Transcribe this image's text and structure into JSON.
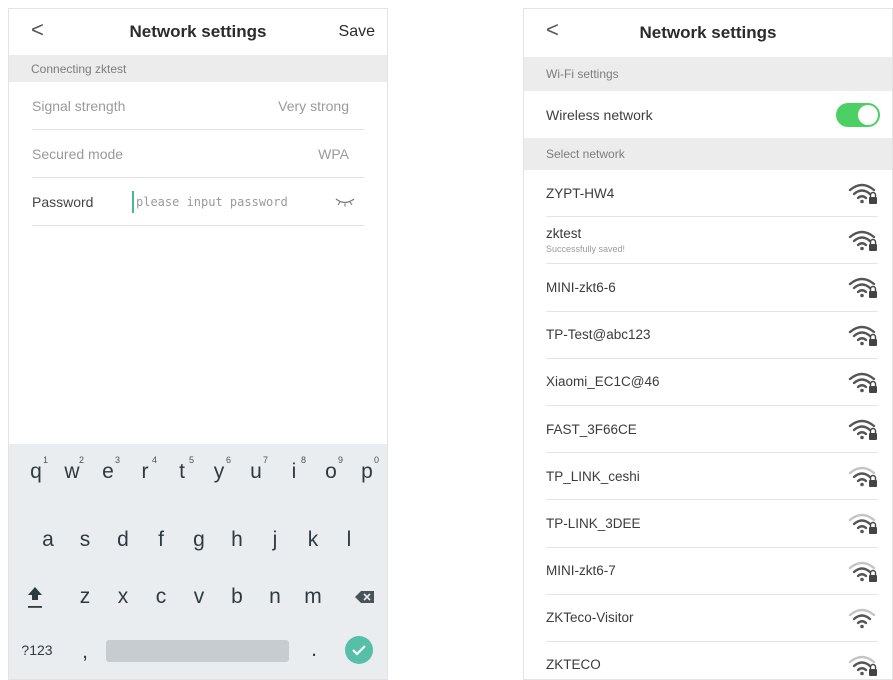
{
  "left": {
    "header": {
      "back": "<",
      "title": "Network settings",
      "save": "Save"
    },
    "section": "Connecting zktest",
    "rows": [
      {
        "label": "Signal strength",
        "value": "Very strong"
      },
      {
        "label": "Secured mode",
        "value": "WPA"
      }
    ],
    "password": {
      "label": "Password",
      "placeholder": "please input password",
      "value": ""
    },
    "keyboard": {
      "row1": [
        [
          "q",
          "1"
        ],
        [
          "w",
          "2"
        ],
        [
          "e",
          "3"
        ],
        [
          "r",
          "4"
        ],
        [
          "t",
          "5"
        ],
        [
          "y",
          "6"
        ],
        [
          "u",
          "7"
        ],
        [
          "i",
          "8"
        ],
        [
          "o",
          "9"
        ],
        [
          "p",
          "0"
        ]
      ],
      "row2": [
        "a",
        "s",
        "d",
        "f",
        "g",
        "h",
        "j",
        "k",
        "l"
      ],
      "row3": [
        "z",
        "x",
        "c",
        "v",
        "b",
        "n",
        "m"
      ],
      "symbols": "?123",
      "comma": ",",
      "period": "."
    }
  },
  "right": {
    "header": {
      "back": "<",
      "title": "Network settings"
    },
    "wifi_section": "Wi-Fi settings",
    "wireless_label": "Wireless network",
    "wireless_on": true,
    "select_section": "Select network",
    "networks": [
      {
        "name": "ZYPT-HW4",
        "status": "",
        "strength": "full"
      },
      {
        "name": "zktest",
        "status": "Successfully saved!",
        "strength": "full"
      },
      {
        "name": "MINI-zkt6-6",
        "status": "",
        "strength": "full"
      },
      {
        "name": "TP-Test@abc123",
        "status": "",
        "strength": "full"
      },
      {
        "name": "Xiaomi_EC1C@46",
        "status": "",
        "strength": "full"
      },
      {
        "name": "FAST_3F66CE",
        "status": "",
        "strength": "full"
      },
      {
        "name": "TP_LINK_ceshi",
        "status": "",
        "strength": "medium"
      },
      {
        "name": "TP-LINK_3DEE",
        "status": "",
        "strength": "medium"
      },
      {
        "name": "MINI-zkt6-7",
        "status": "",
        "strength": "medium"
      },
      {
        "name": "ZKTeco-Visitor",
        "status": "",
        "strength": "open"
      },
      {
        "name": "ZKTECO",
        "status": "",
        "strength": "medium"
      }
    ]
  },
  "colors": {
    "accent": "#55bfa7",
    "toggle": "#4cd064",
    "section_bg": "#ececec",
    "keyboard_bg": "#e9edf0"
  }
}
